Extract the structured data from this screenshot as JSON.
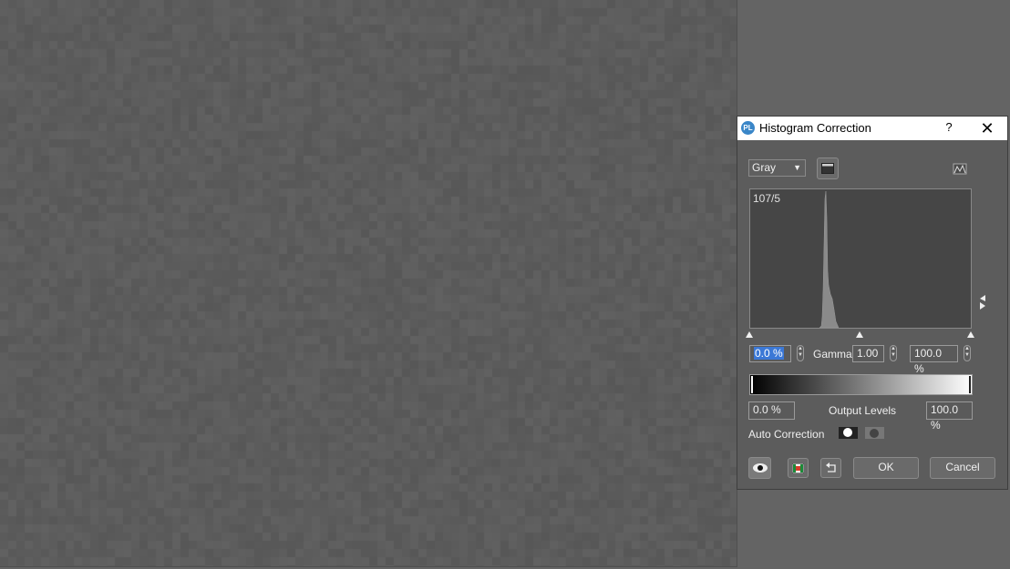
{
  "dialog": {
    "title": "Histogram Correction",
    "help_label": "?",
    "close_label": "✕",
    "logo_label": "PL"
  },
  "channel": {
    "selected": "Gray"
  },
  "histogram": {
    "label": "107/5"
  },
  "input_levels": {
    "black": "0.0 %",
    "gamma_label": "Gamma:",
    "gamma": "1.00",
    "white": "100.0 %"
  },
  "output_levels": {
    "low": "0.0 %",
    "label": "Output Levels",
    "high": "100.0 %"
  },
  "auto_correction": {
    "label": "Auto Correction"
  },
  "buttons": {
    "ok": "OK",
    "cancel": "Cancel"
  },
  "icons": [
    "preview-eye-icon",
    "flag-icon",
    "reset-icon",
    "histogram-options-icon",
    "auto-white-icon",
    "auto-dark-icon",
    "panel-toggle-icon",
    "channel-bar-icon"
  ]
}
